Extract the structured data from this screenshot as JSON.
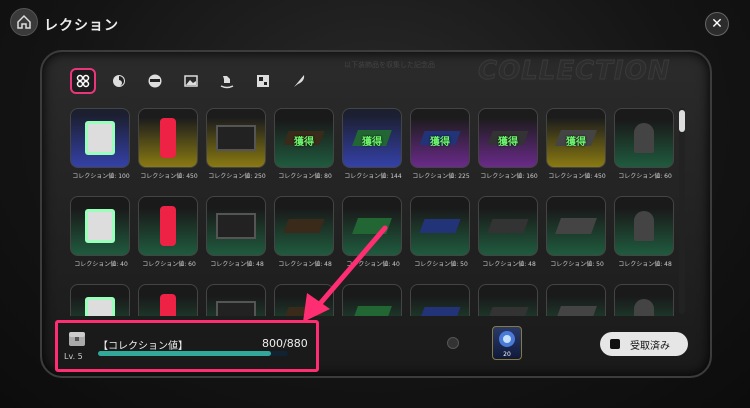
{
  "header": {
    "title": "レクション"
  },
  "watermark": {
    "big": "COLLECTION",
    "small": "以下装飾品を収集した記念品"
  },
  "tabs": [
    {
      "name": "tab-all",
      "icon": "grid-icon",
      "active": true
    },
    {
      "name": "tab-skill",
      "icon": "swirl-icon",
      "active": false
    },
    {
      "name": "tab-face",
      "icon": "face-icon",
      "active": false
    },
    {
      "name": "tab-image",
      "icon": "image-icon",
      "active": false
    },
    {
      "name": "tab-rocking-horse",
      "icon": "horse-icon",
      "active": false
    },
    {
      "name": "tab-board",
      "icon": "board-icon",
      "active": false
    },
    {
      "name": "tab-feather",
      "icon": "feather-icon",
      "active": false
    }
  ],
  "items": [
    {
      "bg": "blue",
      "label": "コレクション値: 100",
      "owned": ""
    },
    {
      "bg": "gold",
      "label": "コレクション値: 450",
      "owned": ""
    },
    {
      "bg": "gold",
      "label": "コレクション値: 250",
      "owned": ""
    },
    {
      "bg": "green",
      "label": "コレクション値: 80",
      "owned": "獲得"
    },
    {
      "bg": "blue",
      "label": "コレクション値: 144",
      "owned": "獲得"
    },
    {
      "bg": "purple",
      "label": "コレクション値: 225",
      "owned": "獲得"
    },
    {
      "bg": "purple",
      "label": "コレクション値: 160",
      "owned": "獲得"
    },
    {
      "bg": "gold",
      "label": "コレクション値: 450",
      "owned": "獲得"
    },
    {
      "bg": "green",
      "label": "コレクション値: 60",
      "owned": ""
    },
    {
      "bg": "green",
      "label": "コレクション値: 40",
      "owned": ""
    },
    {
      "bg": "green",
      "label": "コレクション値: 60",
      "owned": ""
    },
    {
      "bg": "green",
      "label": "コレクション値: 48",
      "owned": ""
    },
    {
      "bg": "green",
      "label": "コレクション値: 48",
      "owned": ""
    },
    {
      "bg": "green",
      "label": "コレクション値: 40",
      "owned": ""
    },
    {
      "bg": "green",
      "label": "コレクション値: 50",
      "owned": ""
    },
    {
      "bg": "green",
      "label": "コレクション値: 48",
      "owned": ""
    },
    {
      "bg": "green",
      "label": "コレクション値: 50",
      "owned": ""
    },
    {
      "bg": "green",
      "label": "コレクション値: 48",
      "owned": ""
    },
    {
      "bg": "green",
      "label": "",
      "owned": ""
    },
    {
      "bg": "green",
      "label": "",
      "owned": ""
    },
    {
      "bg": "green",
      "label": "",
      "owned": ""
    },
    {
      "bg": "green",
      "label": "",
      "owned": ""
    },
    {
      "bg": "green",
      "label": "",
      "owned": ""
    },
    {
      "bg": "green",
      "label": "",
      "owned": ""
    },
    {
      "bg": "green",
      "label": "",
      "owned": ""
    },
    {
      "bg": "green",
      "label": "",
      "owned": ""
    },
    {
      "bg": "green",
      "label": "",
      "owned": ""
    }
  ],
  "collection": {
    "level": "Lv. 5",
    "label": "【コレクション値】",
    "value": "800/880",
    "progress": 0.909
  },
  "reward": {
    "count": "20"
  },
  "claim_button": {
    "label": "受取済み"
  },
  "colors": {
    "highlight": "#ff2e73",
    "progress": "#31a89a",
    "owned": "#6cf26c"
  }
}
